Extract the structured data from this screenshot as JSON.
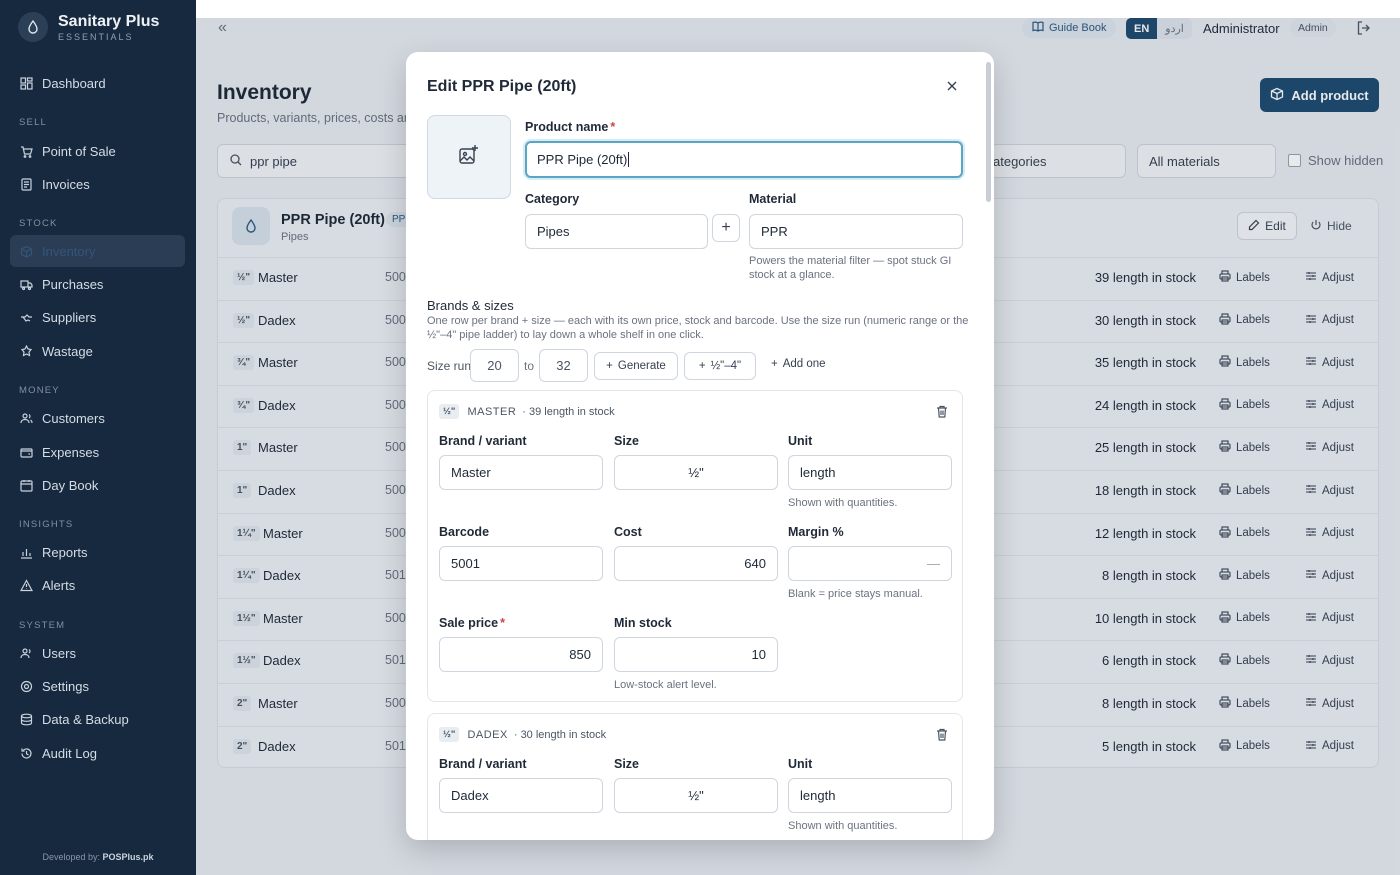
{
  "app": {
    "name": "Sanitary Plus",
    "subtitle": "ESSENTIALS",
    "developer_prefix": "Developed by:",
    "developer": "POSPlus.pk"
  },
  "sidebar": {
    "sections": [
      {
        "label": "SELL"
      },
      {
        "label": "STOCK"
      },
      {
        "label": "MONEY"
      },
      {
        "label": "INSIGHTS"
      },
      {
        "label": "SYSTEM"
      }
    ],
    "items": [
      {
        "label": "Dashboard",
        "icon": "dashboard-icon"
      },
      {
        "label": "Point of Sale",
        "icon": "cart-icon"
      },
      {
        "label": "Invoices",
        "icon": "invoice-icon"
      },
      {
        "label": "Inventory",
        "icon": "box-icon",
        "active": true
      },
      {
        "label": "Purchases",
        "icon": "truck-icon"
      },
      {
        "label": "Suppliers",
        "icon": "supplier-icon"
      },
      {
        "label": "Wastage",
        "icon": "wastage-icon"
      },
      {
        "label": "Customers",
        "icon": "users-icon"
      },
      {
        "label": "Expenses",
        "icon": "wallet-icon"
      },
      {
        "label": "Day Book",
        "icon": "calendar-icon"
      },
      {
        "label": "Reports",
        "icon": "chart-icon"
      },
      {
        "label": "Alerts",
        "icon": "alert-icon"
      },
      {
        "label": "Users",
        "icon": "user-icon"
      },
      {
        "label": "Settings",
        "icon": "gear-icon"
      },
      {
        "label": "Data & Backup",
        "icon": "database-icon"
      },
      {
        "label": "Audit Log",
        "icon": "history-icon"
      }
    ]
  },
  "topbar": {
    "guide_book": "Guide Book",
    "lang_en": "EN",
    "lang_ur": "اردو",
    "user_name": "Administrator",
    "role": "Admin"
  },
  "page": {
    "title": "Inventory",
    "subtitle": "Products, variants, prices, costs and",
    "add_product": "Add product",
    "search_value": "ppr pipe",
    "category_filter": "ategories",
    "material_filter": "All materials",
    "show_hidden": "Show hidden"
  },
  "product": {
    "name": "PPR Pipe (20ft)",
    "tag": "PP",
    "category": "Pipes",
    "edit": "Edit",
    "hide": "Hide",
    "labels_btn": "Labels",
    "adjust_btn": "Adjust",
    "variants": [
      {
        "size": "½\"",
        "brand": "Master",
        "code": "500",
        "stock": "39 length in stock"
      },
      {
        "size": "½\"",
        "brand": "Dadex",
        "code": "500",
        "stock": "30 length in stock"
      },
      {
        "size": "¾\"",
        "brand": "Master",
        "code": "500",
        "stock": "35 length in stock"
      },
      {
        "size": "¾\"",
        "brand": "Dadex",
        "code": "500",
        "stock": "24 length in stock"
      },
      {
        "size": "1\"",
        "brand": "Master",
        "code": "500",
        "stock": "25 length in stock"
      },
      {
        "size": "1\"",
        "brand": "Dadex",
        "code": "500",
        "stock": "18 length in stock"
      },
      {
        "size": "1¼\"",
        "brand": "Master",
        "code": "500",
        "stock": "12 length in stock"
      },
      {
        "size": "1¼\"",
        "brand": "Dadex",
        "code": "501",
        "stock": "8 length in stock"
      },
      {
        "size": "1½\"",
        "brand": "Master",
        "code": "500",
        "stock": "10 length in stock"
      },
      {
        "size": "1½\"",
        "brand": "Dadex",
        "code": "501",
        "stock": "6 length in stock"
      },
      {
        "size": "2\"",
        "brand": "Master",
        "code": "500",
        "stock": "8 length in stock"
      },
      {
        "size": "2\"",
        "brand": "Dadex",
        "code": "501",
        "stock": "5 length in stock"
      }
    ]
  },
  "modal": {
    "title": "Edit PPR Pipe (20ft)",
    "product_name_label": "Product name",
    "product_name_value": "PPR Pipe (20ft)",
    "required_mark": "*",
    "category_label": "Category",
    "category_value": "Pipes",
    "add_category": "+",
    "material_label": "Material",
    "material_value": "PPR",
    "material_help": "Powers the material filter — spot stuck GI stock at a glance.",
    "brands_title": "Brands & sizes",
    "brands_desc": "One row per brand + size — each with its own price, stock and barcode. Use the size run (numeric range or the ½\"–4\" pipe ladder) to lay down a whole shelf in one click.",
    "size_run_label": "Size run",
    "size_run_from": "20",
    "size_run_to_label": "to",
    "size_run_to": "32",
    "generate": "Generate",
    "ladder": "½\"–4\"",
    "add_one": "Add one",
    "variants": [
      {
        "size_badge": "½\"",
        "brand_caps": "MASTER",
        "stock_note": "· 39 length in stock",
        "brand_label": "Brand / variant",
        "brand": "Master",
        "size_label": "Size",
        "size": "½\"",
        "unit_label": "Unit",
        "unit": "length",
        "unit_help": "Shown with quantities.",
        "barcode_label": "Barcode",
        "barcode": "5001",
        "cost_label": "Cost",
        "cost": "640",
        "margin_label": "Margin %",
        "margin": "—",
        "margin_help": "Blank = price stays manual.",
        "sale_label": "Sale price",
        "sale": "850",
        "min_label": "Min stock",
        "min": "10",
        "min_help": "Low-stock alert level."
      },
      {
        "size_badge": "½\"",
        "brand_caps": "DADEX",
        "stock_note": "· 30 length in stock",
        "brand_label": "Brand / variant",
        "brand": "Dadex",
        "size_label": "Size",
        "size": "½\"",
        "unit_label": "Unit",
        "unit": "length",
        "unit_help": "Shown with quantities."
      }
    ]
  },
  "colors": {
    "sidebar_bg": "#17293e",
    "accent": "#1e4a70",
    "focus_ring": "#5aa5c4",
    "required": "#d14343"
  }
}
